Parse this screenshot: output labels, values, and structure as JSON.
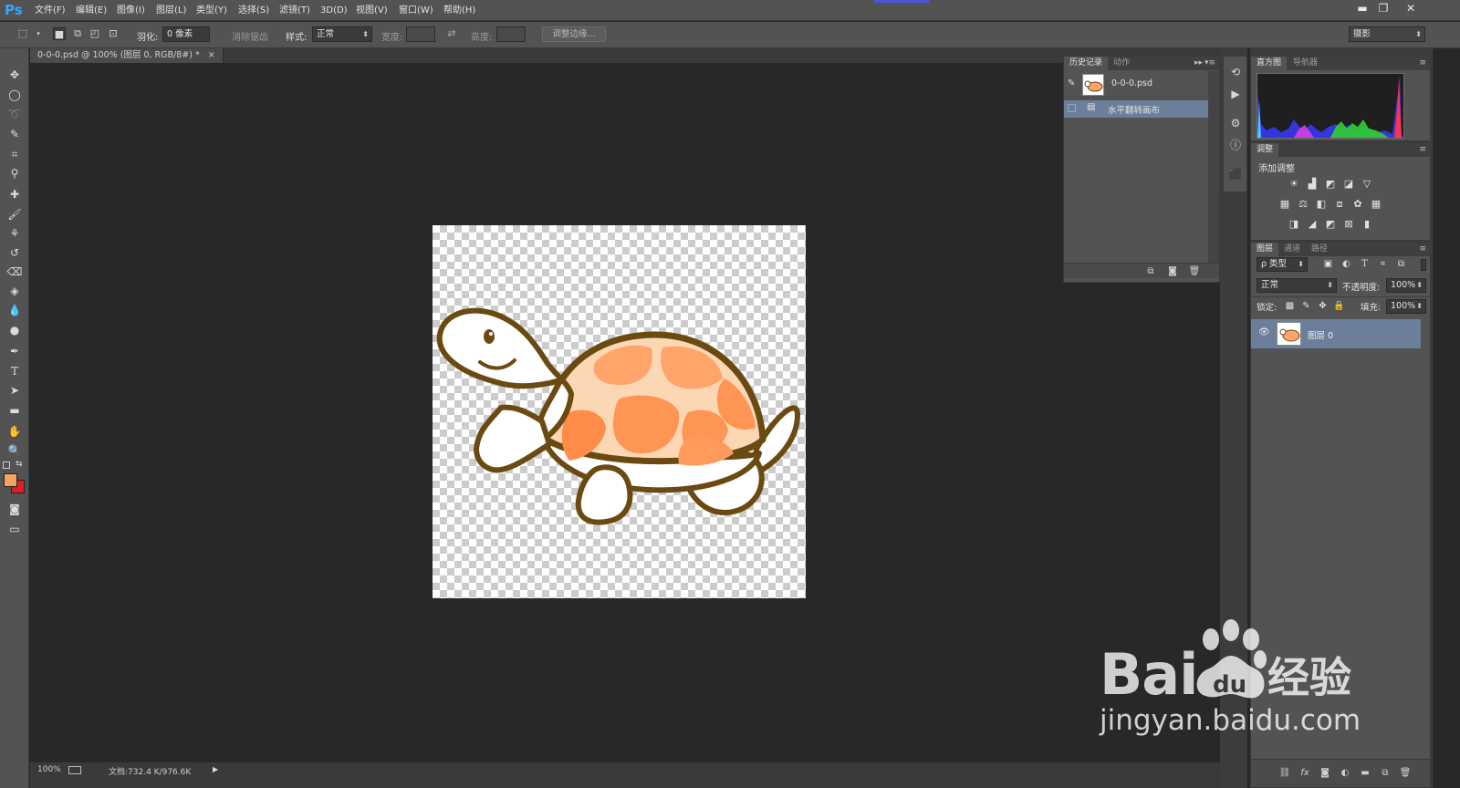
{
  "app": {
    "logo": "Ps"
  },
  "menu": [
    "文件(F)",
    "编辑(E)",
    "图像(I)",
    "图层(L)",
    "类型(Y)",
    "选择(S)",
    "滤镜(T)",
    "3D(D)",
    "视图(V)",
    "窗口(W)",
    "帮助(H)"
  ],
  "window_controls": {
    "minimize": "▬",
    "restore": "❐",
    "close": "✕"
  },
  "options": {
    "feather_label": "羽化:",
    "feather_value": "0 像素",
    "antialias_label": "消除锯齿",
    "style_label": "样式:",
    "style_value": "正常",
    "width_label": "宽度:",
    "height_label": "高度:",
    "refine_edge_button": "调整边缘...",
    "workspace_value": "摄影"
  },
  "document": {
    "tab_title": "0-0-0.psd @ 100% (图层 0, RGB/8#) *",
    "tab_close": "×"
  },
  "status": {
    "zoom": "100%",
    "doc_size": "文档:732.4 K/976.6K"
  },
  "history_panel": {
    "tabs": [
      "历史记录",
      "动作"
    ],
    "snapshot_name": "0-0-0.psd",
    "step_name": "水平翻转画布"
  },
  "histogram_panel": {
    "tabs": [
      "直方图",
      "导航器"
    ]
  },
  "adjustments_panel": {
    "tab": "调整",
    "title": "添加调整"
  },
  "layers_panel": {
    "tabs": [
      "图层",
      "通道",
      "路径"
    ],
    "filter_value": "ρ 类型",
    "blend_mode": "正常",
    "opacity_label": "不透明度:",
    "opacity_value": "100%",
    "lock_label": "锁定:",
    "fill_label": "填充:",
    "fill_value": "100%",
    "layer_name": "图层 0"
  },
  "watermark": {
    "brand": "Bai",
    "paw_text": "du",
    "cn": "经验",
    "url": "jingyan.baidu.com"
  },
  "colors": {
    "foreground": "#f4a460",
    "background": "#e02020",
    "selection_row": "#6c7f9a",
    "ps_blue": "#31a8ff"
  }
}
